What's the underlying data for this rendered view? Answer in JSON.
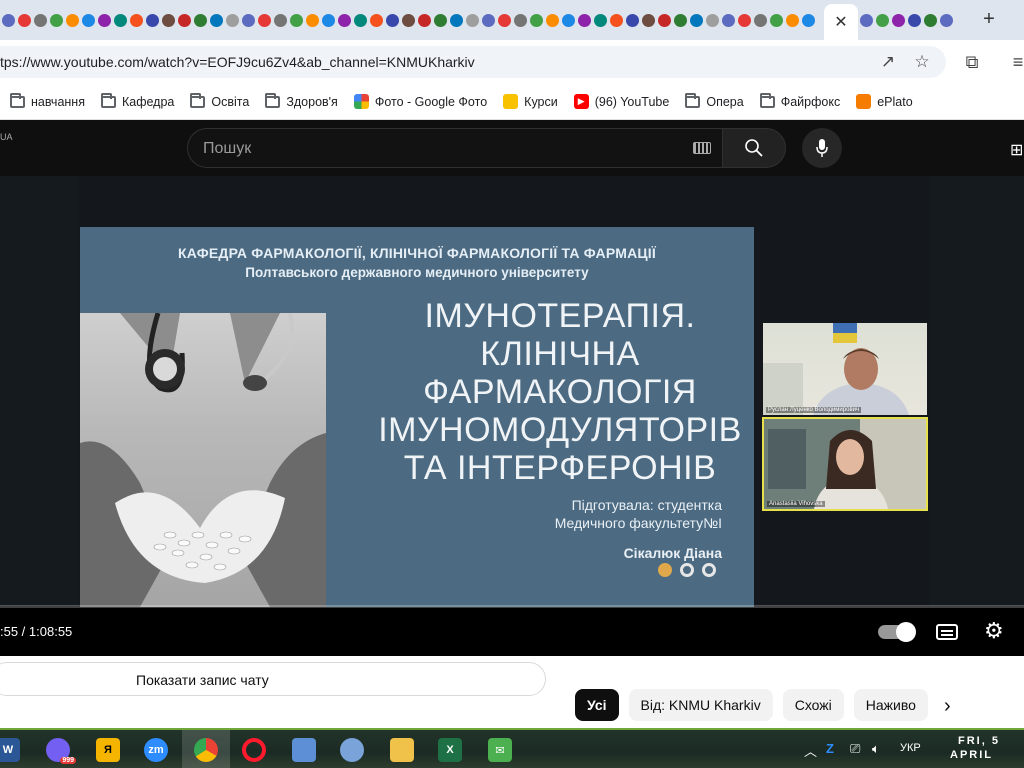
{
  "browser": {
    "active_tab_close": "✕",
    "new_tab": "+",
    "url": "tps://www.youtube.com/watch?v=EOFJ9cu6Zv4&ab_channel=KNMUKharkiv",
    "bookmarks": [
      {
        "label": "навчання",
        "icon": "folder-icon"
      },
      {
        "label": "Кафедра",
        "icon": "folder-icon"
      },
      {
        "label": "Освіта",
        "icon": "folder-icon"
      },
      {
        "label": "Здоров'я",
        "icon": "folder-icon"
      },
      {
        "label": "Фото - Google Фото",
        "icon": "google-photos-icon"
      },
      {
        "label": "Курси",
        "icon": "courses-icon"
      },
      {
        "label": "(96) YouTube",
        "icon": "youtube-icon"
      },
      {
        "label": "Опера",
        "icon": "folder-icon"
      },
      {
        "label": "Файрфокс",
        "icon": "folder-icon"
      },
      {
        "label": "ePlato",
        "icon": "eplato-icon"
      }
    ]
  },
  "youtube": {
    "left_label": "UA",
    "search_placeholder": "Пошук",
    "time": ":55 / 1:08:55",
    "progress": 0.0,
    "chat_button": "Показати запис чату",
    "chips": [
      "Усі",
      "Від: KNMU Kharkiv",
      "Схожі",
      "Наживо"
    ]
  },
  "slide": {
    "dept_line1": "КАФЕДРА ФАРМАКОЛОГІЇ, КЛІНІЧНОЇ ФАРМАКОЛОГІЇ ТА ФАРМАЦІЇ",
    "dept_line2": "Полтавського державного медичного університету",
    "title": [
      "ІМУНОТЕРАПІЯ.",
      "КЛІНІЧНА",
      "ФАРМАКОЛОГІЯ",
      "ІМУНОМОДУЛЯТОРІВ",
      "ТА ІНТЕРФЕРОНІВ"
    ],
    "prepared_by": "Підготувала: студентка",
    "faculty": "Медичного факультету№І",
    "author": "Сікалюк Діана"
  },
  "participants": [
    {
      "name": "Руслан Луценко Володимирович"
    },
    {
      "name": "Anastasiia Vihovska"
    }
  ],
  "taskbar": {
    "language": "УКР",
    "badge": "999",
    "date_line1": "FRI, 5",
    "date_line2": "APRIL"
  },
  "colors": {
    "slide_bg": "#4c6b82",
    "active_dot": "#e0a84b",
    "progress": "#ff0000",
    "speaker_frame": "#e6e04a"
  }
}
